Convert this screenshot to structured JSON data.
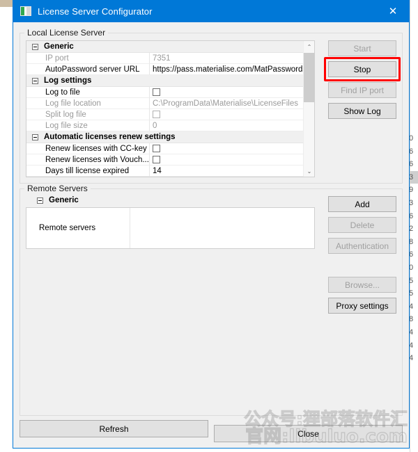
{
  "window": {
    "title": "License Server Configurator",
    "icon": "app-icon",
    "close_label": "✕"
  },
  "local_group": {
    "legend": "Local License Server",
    "rows": [
      {
        "type": "category",
        "name": "Generic",
        "value": "",
        "disabled": false
      },
      {
        "type": "text",
        "name": "IP port",
        "value": "7351",
        "disabled": true
      },
      {
        "type": "text",
        "name": "AutoPassword server URL",
        "value": "https://pass.materialise.com/MatPasswordsWS/M",
        "disabled": false
      },
      {
        "type": "category",
        "name": "Log settings",
        "value": "",
        "disabled": false
      },
      {
        "type": "check",
        "name": "Log to file",
        "value": "",
        "disabled": false
      },
      {
        "type": "text",
        "name": "Log file location",
        "value": "C:\\ProgramData\\Materialise\\LicenseFiles",
        "disabled": true
      },
      {
        "type": "check",
        "name": "Split log file",
        "value": "",
        "disabled": true
      },
      {
        "type": "text",
        "name": "Log file size",
        "value": "0",
        "disabled": true
      },
      {
        "type": "category",
        "name": "Automatic licenses renew settings",
        "value": "",
        "disabled": false
      },
      {
        "type": "check",
        "name": "Renew licenses with CC-key",
        "value": "",
        "disabled": false
      },
      {
        "type": "check",
        "name": "Renew licenses with Vouch...",
        "value": "",
        "disabled": false
      },
      {
        "type": "text",
        "name": "Days till license expired",
        "value": "14",
        "disabled": false
      }
    ],
    "scrollbar": {
      "up": "⌃",
      "down": "⌄"
    },
    "buttons": [
      {
        "label": "Start",
        "disabled": true,
        "highlighted": false
      },
      {
        "label": "Stop",
        "disabled": false,
        "highlighted": true
      },
      {
        "label": "Find IP port",
        "disabled": true,
        "highlighted": false
      },
      {
        "label": "Show Log",
        "disabled": false,
        "highlighted": false
      }
    ]
  },
  "remote_group": {
    "legend": "Remote Servers",
    "category": "Generic",
    "row_name": "Remote servers",
    "row_value": "",
    "buttons": [
      {
        "label": "Add",
        "disabled": false
      },
      {
        "label": "Delete",
        "disabled": true
      },
      {
        "label": "Authentication",
        "disabled": true
      }
    ],
    "buttons2": [
      {
        "label": "Browse...",
        "disabled": true
      },
      {
        "label": "Proxy settings",
        "disabled": false
      }
    ]
  },
  "bottom": {
    "refresh_label": "Refresh",
    "close_label": "Close"
  },
  "watermark": {
    "line1": "公众号:狸部落软件汇",
    "line2": "官网:libuluo.com"
  },
  "background": {
    "column_values": [
      "0",
      "6",
      "6",
      "3",
      "9",
      "3",
      "6",
      "2",
      "8",
      "6",
      "0",
      "5",
      "5",
      "4",
      "8",
      "4",
      "4",
      "4"
    ],
    "selected_index": 3
  },
  "colors": {
    "accent": "#0078d7",
    "highlight": "#ff0000",
    "dialog_bg": "#f0f0f0",
    "button_bg": "#e1e1e1"
  }
}
